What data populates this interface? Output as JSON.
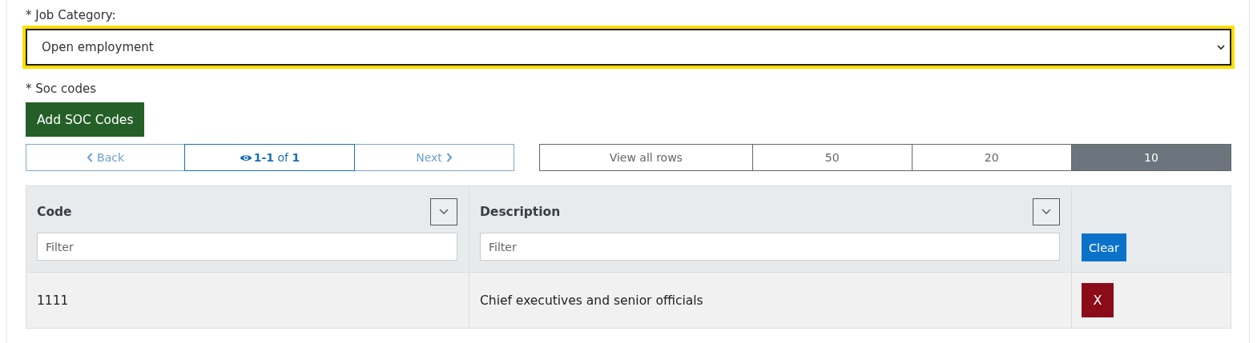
{
  "job_category": {
    "label": "* Job Category:",
    "value": "Open employment",
    "focused": true
  },
  "soc_codes": {
    "label": "* Soc codes",
    "add_button": "Add SOC Codes"
  },
  "pager": {
    "back": {
      "label": "Back",
      "disabled": true
    },
    "status": "**1-1** of **1**",
    "next": {
      "label": "Next",
      "disabled": true
    }
  },
  "page_sizes": [
    {
      "label": "View all rows",
      "selected": false
    },
    {
      "label": "50",
      "selected": false
    },
    {
      "label": "20",
      "selected": false
    },
    {
      "label": "10",
      "selected": true
    }
  ],
  "table": {
    "columns": [
      {
        "title": "Code",
        "filter_placeholder": "Filter"
      },
      {
        "title": "Description",
        "filter_placeholder": "Filter"
      }
    ],
    "clear_button": "Clear",
    "rows": [
      {
        "code": "1111",
        "description": "Chief executives and senior officials",
        "remove_button": "X"
      }
    ]
  }
}
